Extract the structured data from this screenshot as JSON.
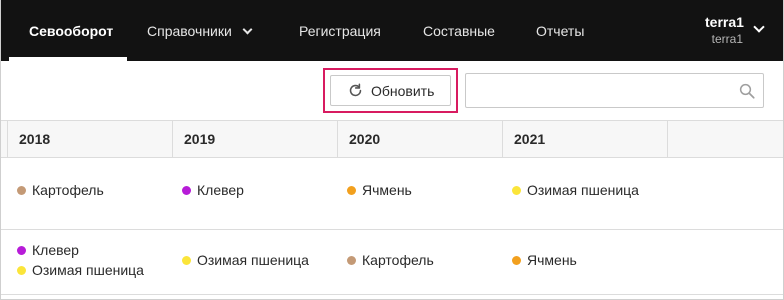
{
  "nav": {
    "items": [
      {
        "label": "Севооборот",
        "active": true
      },
      {
        "label": "Справочники",
        "has_dropdown": true
      },
      {
        "label": "Регистрация"
      },
      {
        "label": "Составные"
      },
      {
        "label": "Отчеты"
      }
    ],
    "user": {
      "name": "terra1",
      "sub": "terra1"
    }
  },
  "toolbar": {
    "refresh_label": "Обновить",
    "search_value": "",
    "search_placeholder": ""
  },
  "colors": {
    "Картофель": "#c49a76",
    "Клевер": "#b71cd8",
    "Ячмень": "#f2a01e",
    "Озимая пшеница": "#fbe53a",
    "highlight": "#d81b60"
  },
  "table": {
    "columns": [
      "2018",
      "2019",
      "2020",
      "2021"
    ],
    "rows": [
      {
        "cells": [
          [
            "Картофель"
          ],
          [
            "Клевер"
          ],
          [
            "Ячмень"
          ],
          [
            "Озимая пшеница"
          ]
        ]
      },
      {
        "cells": [
          [
            "Клевер",
            "Озимая пшеница"
          ],
          [
            "Озимая пшеница"
          ],
          [
            "Картофель"
          ],
          [
            "Ячмень"
          ]
        ]
      }
    ]
  }
}
